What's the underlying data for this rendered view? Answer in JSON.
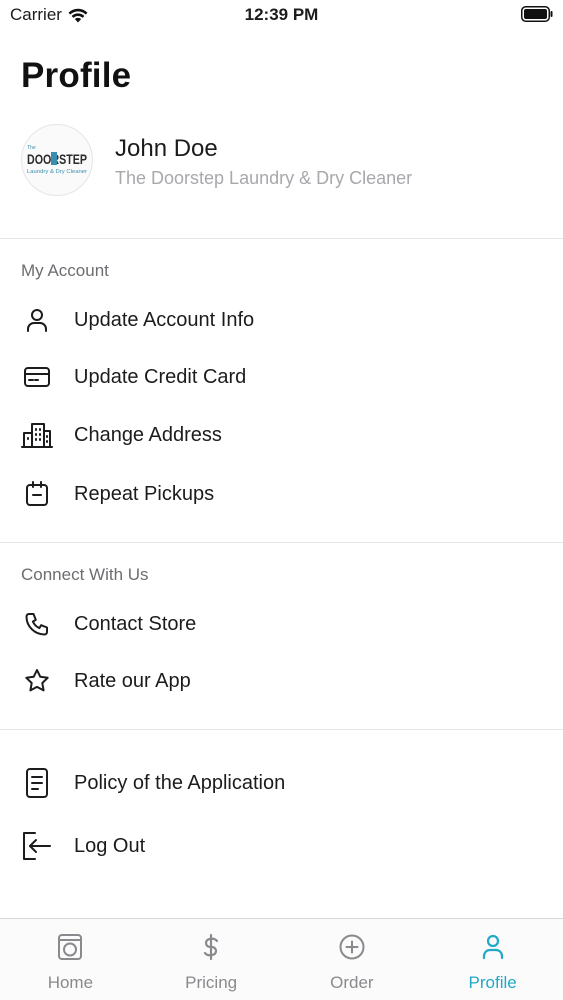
{
  "status_bar": {
    "carrier": "Carrier",
    "time": "12:39 PM"
  },
  "header": {
    "title": "Profile"
  },
  "profile": {
    "name": "John Doe",
    "store": "The Doorstep Laundry & Dry Cleaner",
    "logo": {
      "small_text": "The",
      "main_text": "DOORSTEP",
      "tagline": "Laundry & Dry Cleaner"
    }
  },
  "sections": {
    "my_account": {
      "label": "My Account",
      "items": [
        {
          "label": "Update Account Info",
          "icon": "person-icon"
        },
        {
          "label": "Update Credit Card",
          "icon": "credit-card-icon"
        },
        {
          "label": "Change Address",
          "icon": "buildings-icon"
        },
        {
          "label": "Repeat Pickups",
          "icon": "calendar-icon"
        }
      ]
    },
    "connect": {
      "label": "Connect With Us",
      "items": [
        {
          "label": "Contact Store",
          "icon": "phone-icon"
        },
        {
          "label": "Rate our App",
          "icon": "star-icon"
        }
      ]
    },
    "other": {
      "items": [
        {
          "label": "Policy of the Application",
          "icon": "document-icon"
        },
        {
          "label": "Log Out",
          "icon": "logout-icon"
        }
      ]
    }
  },
  "tab_bar": {
    "tabs": [
      {
        "label": "Home",
        "icon": "washer-icon",
        "active": false
      },
      {
        "label": "Pricing",
        "icon": "dollar-icon",
        "active": false
      },
      {
        "label": "Order",
        "icon": "plus-circle-icon",
        "active": false
      },
      {
        "label": "Profile",
        "icon": "person-icon",
        "active": true
      }
    ]
  },
  "colors": {
    "accent": "#23a9c8",
    "text_primary": "#1c1c1e",
    "text_secondary": "#a8a8ad",
    "section_label": "#6d6d72",
    "tab_inactive": "#8a8a8e",
    "divider": "#e6e6e9"
  }
}
